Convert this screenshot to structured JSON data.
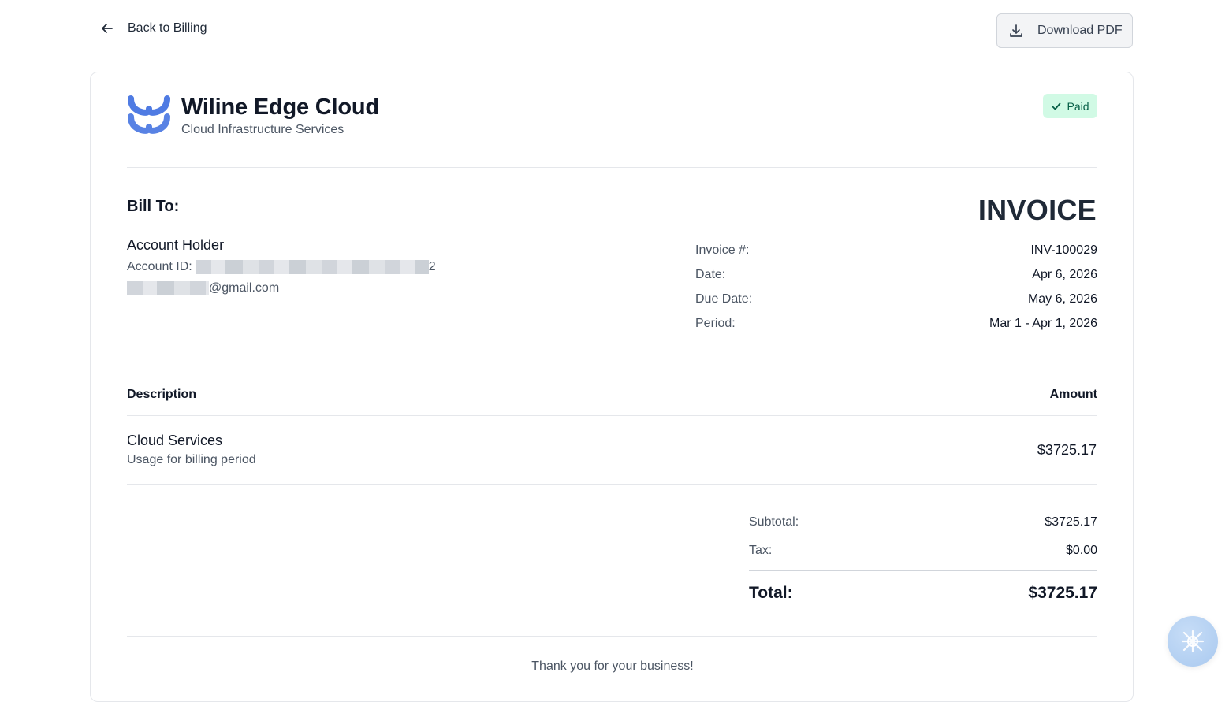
{
  "header": {
    "back_label": "Back to Billing",
    "download_label": "Download PDF"
  },
  "company": {
    "name": "Wiline Edge Cloud",
    "tagline": "Cloud Infrastructure Services",
    "brand_color": "#4f7be3"
  },
  "status": {
    "label": "Paid",
    "color": "#065f46",
    "background": "#d1fae5"
  },
  "bill_to": {
    "heading": "Bill To:",
    "name": "Account Holder",
    "account_id_label": "Account ID:",
    "account_id_tail": "2",
    "email_suffix": "@gmail.com"
  },
  "invoice": {
    "title": "INVOICE",
    "meta": [
      {
        "label": "Invoice #:",
        "value": "INV-100029"
      },
      {
        "label": "Date:",
        "value": "Apr 6, 2026"
      },
      {
        "label": "Due Date:",
        "value": "May 6, 2026"
      },
      {
        "label": "Period:",
        "value": "Mar 1 - Apr 1, 2026"
      }
    ]
  },
  "table": {
    "headers": {
      "description": "Description",
      "amount": "Amount"
    },
    "items": [
      {
        "description": "Cloud Services",
        "subtext": "Usage for billing period",
        "amount": "$3725.17"
      }
    ]
  },
  "summary": {
    "subtotal_label": "Subtotal:",
    "subtotal_value": "$3725.17",
    "tax_label": "Tax:",
    "tax_value": "$0.00",
    "total_label": "Total:",
    "total_value": "$3725.17"
  },
  "footer": {
    "thanks": "Thank you for your business!"
  }
}
